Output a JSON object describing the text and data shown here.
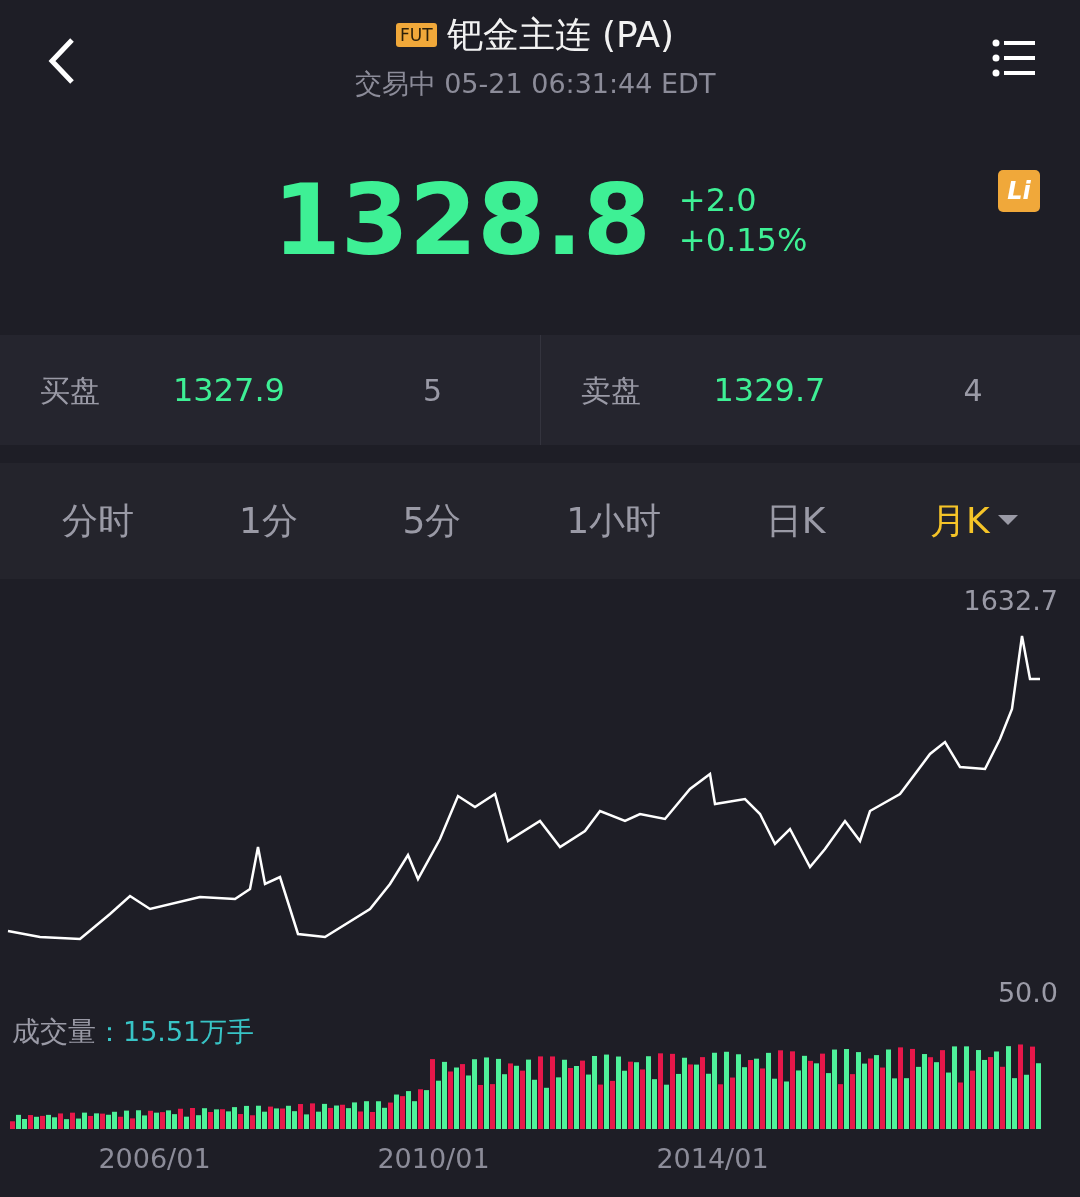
{
  "header": {
    "badge": "FUT",
    "title": "钯金主连 (PA)",
    "status": "交易中 05-21 06:31:44 EDT"
  },
  "quote": {
    "price": "1328.8",
    "change": "+2.0",
    "change_pct": "+0.15%",
    "badge": "Li"
  },
  "order_book": [
    {
      "label": "买盘",
      "price": "1327.9",
      "size": "5"
    },
    {
      "label": "卖盘",
      "price": "1329.7",
      "size": "4"
    }
  ],
  "tabs": [
    {
      "label": "分时",
      "selected": false
    },
    {
      "label": "1分",
      "selected": false
    },
    {
      "label": "5分",
      "selected": false
    },
    {
      "label": "1小时",
      "selected": false
    },
    {
      "label": "日K",
      "selected": false
    },
    {
      "label": "月K",
      "selected": true,
      "dropdown": true
    }
  ],
  "price_chart": {
    "max_label": "1632.7"
  },
  "volume": {
    "max_label": "50.0",
    "label": "成交量",
    "value": "：15.51万手"
  },
  "x_labels": [
    "2006/01",
    "2010/01",
    "2014/01"
  ]
}
